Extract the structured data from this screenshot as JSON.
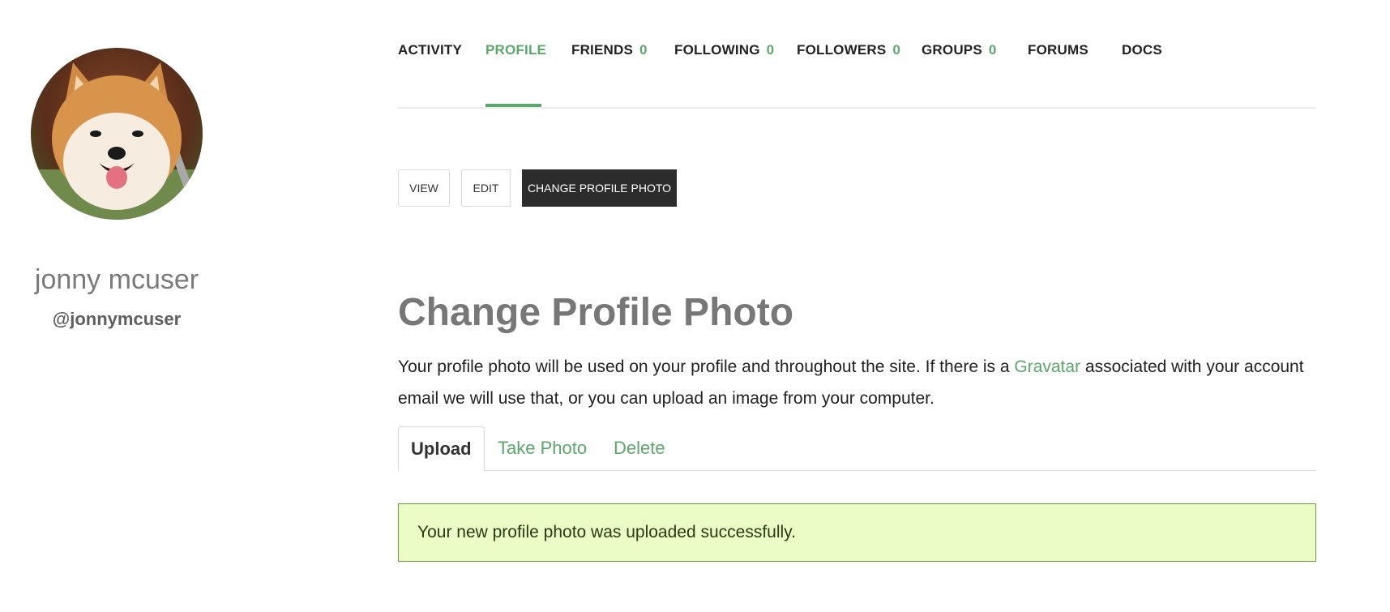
{
  "sidebar": {
    "display_name": "jonny mcuser",
    "username": "@jonnymcuser"
  },
  "nav": {
    "items": [
      {
        "label": "ACTIVITY",
        "count": ""
      },
      {
        "label": "PROFILE",
        "count": ""
      },
      {
        "label": "FRIENDS",
        "count": "0"
      },
      {
        "label": "FOLLOWING",
        "count": "0"
      },
      {
        "label": "FOLLOWERS",
        "count": "0"
      },
      {
        "label": "GROUPS",
        "count": "0"
      },
      {
        "label": "FORUMS",
        "count": ""
      },
      {
        "label": "DOCS",
        "count": ""
      }
    ],
    "active": "PROFILE"
  },
  "subnav": {
    "view": "VIEW",
    "edit": "EDIT",
    "change_photo": "CHANGE PROFILE PHOTO"
  },
  "main": {
    "title": "Change Profile Photo",
    "intro_before": "Your profile photo will be used on your profile and throughout the site. If there is a ",
    "intro_link": "Gravatar",
    "intro_after": " associated with your account email we will use that, or you can upload an image from your computer.",
    "tabs": [
      {
        "label": "Upload"
      },
      {
        "label": "Take Photo"
      },
      {
        "label": "Delete"
      }
    ],
    "notice": "Your new profile photo was uploaded successfully."
  },
  "colors": {
    "accent": "#5aa86a",
    "notice_bg": "#eafdc6",
    "notice_border": "#6b9a3c",
    "dark_button": "#2c2c2c"
  },
  "icons": {
    "avatar": "shiba-inu-dog-photo"
  }
}
